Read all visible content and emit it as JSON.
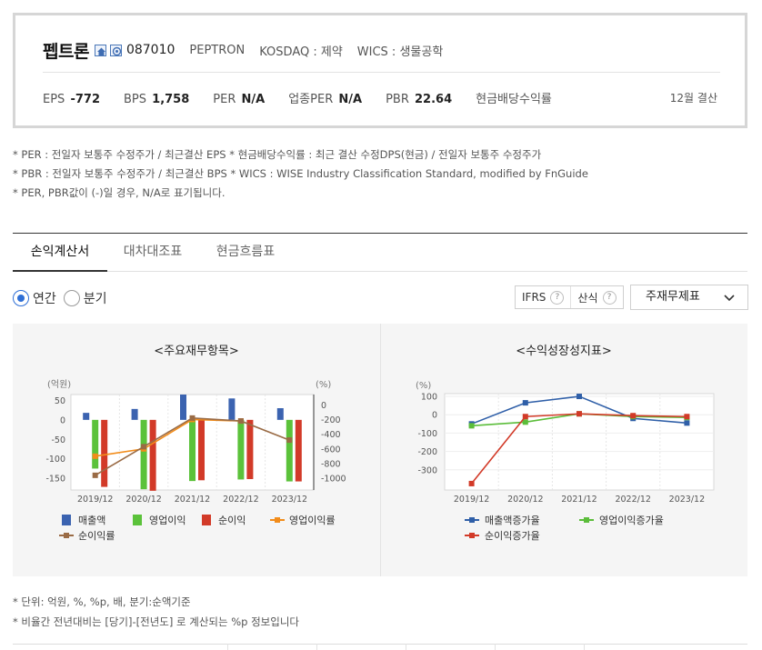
{
  "company": {
    "name": "펩트론",
    "code": "087010",
    "english_name": "PEPTRON",
    "market": "KOSDAQ : 제약",
    "wics": "WICS : 생물공학",
    "icons": [
      "home-icon",
      "ir-icon"
    ]
  },
  "metrics": [
    {
      "label": "EPS",
      "value": "-772"
    },
    {
      "label": "BPS",
      "value": "1,758"
    },
    {
      "label": "PER",
      "value": "N/A"
    },
    {
      "label": "업종PER",
      "value": "N/A"
    },
    {
      "label": "PBR",
      "value": "22.64"
    },
    {
      "label": "현금배당수익률",
      "value": ""
    }
  ],
  "settlement": "12월 결산",
  "notes": [
    "* PER : 전일자 보통주 수정주가 / 최근결산 EPS * 현금배당수익률 : 최근 결산 수정DPS(현금) / 전일자 보통주 수정주가",
    "* PBR : 전일자 보통주 수정주가 / 최근결산 BPS * WICS : WISE Industry Classification Standard, modified by FnGuide",
    "* PER, PBR값이 (-)일 경우, N/A로 표기됩니다."
  ],
  "tabs": [
    "손익계산서",
    "대차대조표",
    "현금흐름표"
  ],
  "period_options": [
    {
      "label": "연간",
      "selected": true
    },
    {
      "label": "분기",
      "selected": false
    }
  ],
  "options": {
    "ifrs_label": "IFRS",
    "calc_label": "산식",
    "help_glyph": "?",
    "statement_select": "주재무제표"
  },
  "chart_titles": {
    "left": "<주요재무항목>",
    "right": "<수익성장성지표>"
  },
  "chart_data": [
    {
      "type": "bar",
      "title": "<주요재무항목>",
      "categories": [
        "2019/12",
        "2020/12",
        "2021/12",
        "2022/12",
        "2023/12"
      ],
      "y_left_unit": "(억원)",
      "y_right_unit": "(%)",
      "y_left_ticks": [
        "50",
        "0",
        "-50",
        "-100",
        "-150"
      ],
      "y_right_ticks": [
        "0",
        "-200",
        "-400",
        "-600",
        "-800",
        "-1000"
      ],
      "ylim_left": [
        -180,
        65
      ],
      "ylim_right": [
        -1160,
        140
      ],
      "series": [
        {
          "name": "매출액",
          "kind": "bar",
          "axis": "left",
          "color": "#3b63b0",
          "values": [
            18,
            28,
            65,
            55,
            30
          ]
        },
        {
          "name": "영업이익",
          "kind": "bar",
          "axis": "left",
          "color": "#5bc23a",
          "values": [
            -125,
            -178,
            -157,
            -153,
            -158
          ]
        },
        {
          "name": "순이익",
          "kind": "bar",
          "axis": "left",
          "color": "#d23a28",
          "values": [
            -172,
            -182,
            -155,
            -152,
            -158
          ]
        },
        {
          "name": "영업이익률",
          "kind": "line",
          "axis": "right",
          "color": "#f28c1a",
          "values": [
            -700,
            -600,
            -200,
            -220,
            null
          ]
        },
        {
          "name": "순이익률",
          "kind": "line",
          "axis": "right",
          "color": "#9a6b45",
          "values": [
            -960,
            -570,
            -180,
            -220,
            -480
          ]
        }
      ],
      "legend_position": "bottom"
    },
    {
      "type": "line",
      "title": "<수익성장성지표>",
      "categories": [
        "2019/12",
        "2020/12",
        "2021/12",
        "2022/12",
        "2023/12"
      ],
      "y_unit": "(%)",
      "y_ticks": [
        "100",
        "0",
        "-100",
        "-200",
        "-300"
      ],
      "ylim": [
        -410,
        115
      ],
      "series": [
        {
          "name": "매출액증가율",
          "color": "#2f5fa8",
          "values": [
            -50,
            65,
            100,
            -20,
            -45
          ]
        },
        {
          "name": "영업이익증가율",
          "color": "#5bbd3a",
          "values": [
            -60,
            -40,
            5,
            -10,
            -15
          ]
        },
        {
          "name": "순이익증가율",
          "color": "#d23a28",
          "values": [
            -375,
            -10,
            5,
            -5,
            -10
          ]
        }
      ],
      "legend_position": "bottom"
    }
  ],
  "units_notes": [
    "* 단위: 억원, %, %p, 배, 분기:순액기준",
    "* 비율간 전년대비는 [당기]-[전년도] 로 계산되는 %p 정보입니다"
  ]
}
